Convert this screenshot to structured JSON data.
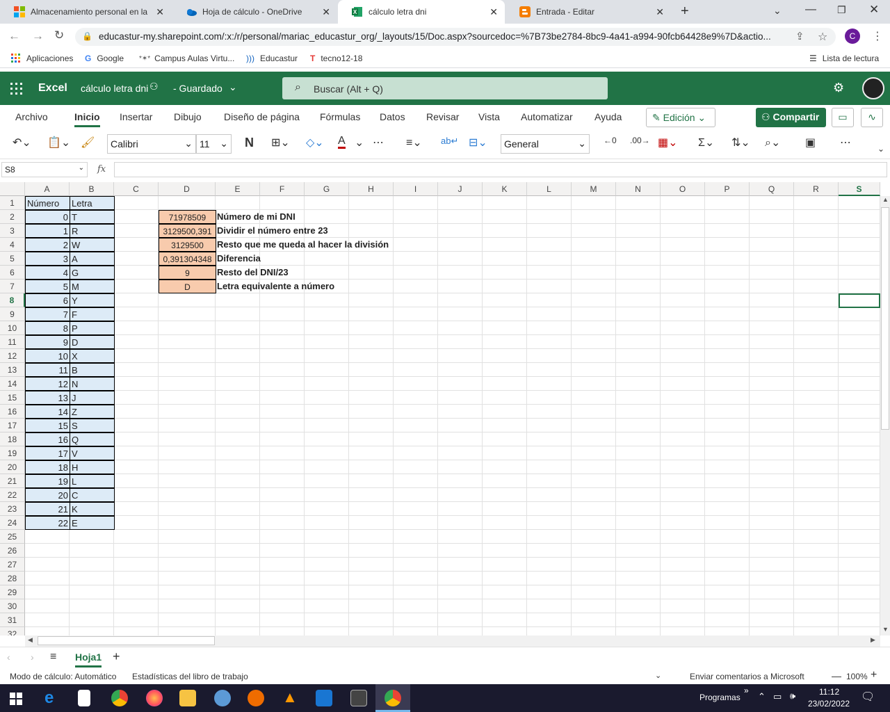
{
  "browser": {
    "tabs": [
      {
        "title": "Almacenamiento personal en la r",
        "icon": "microsoft-icon"
      },
      {
        "title": "Hoja de cálculo - OneDrive",
        "icon": "onedrive-icon"
      },
      {
        "title": "cálculo letra dni",
        "icon": "excel-icon",
        "active": true
      },
      {
        "title": "Entrada - Editar",
        "icon": "blogger-icon"
      }
    ],
    "url": "educastur-my.sharepoint.com/:x:/r/personal/mariac_educastur_org/_layouts/15/Doc.aspx?sourcedoc=%7B73be2784-8bc9-4a41-a994-90fcb64428e9%7D&actio...",
    "profile_initial": "C",
    "bookmarks": [
      "Aplicaciones",
      "Google",
      "Campus Aulas Virtu...",
      "Educastur",
      "tecno12-18"
    ],
    "reading_list": "Lista de lectura"
  },
  "excel": {
    "app_name": "Excel",
    "doc_title": "cálculo letra dni",
    "save_status": "- Guardado",
    "search_placeholder": "Buscar (Alt + Q)",
    "menu": [
      "Archivo",
      "Inicio",
      "Insertar",
      "Dibujo",
      "Diseño de página",
      "Fórmulas",
      "Datos",
      "Revisar",
      "Vista",
      "Automatizar",
      "Ayuda"
    ],
    "edit_mode": "Edición",
    "share": "Compartir",
    "font": "Calibri",
    "font_size": "11",
    "bold": "N",
    "number_format": "General",
    "name_box": "S8",
    "fx": "fx"
  },
  "columns": [
    "A",
    "B",
    "C",
    "D",
    "E",
    "F",
    "G",
    "H",
    "I",
    "J",
    "K",
    "L",
    "M",
    "N",
    "O",
    "P",
    "Q",
    "R",
    "S"
  ],
  "rows": [
    "1",
    "2",
    "3",
    "4",
    "5",
    "6",
    "7",
    "8",
    "9",
    "10",
    "11",
    "12",
    "13",
    "14",
    "15",
    "16",
    "17",
    "18",
    "19",
    "20",
    "21",
    "22",
    "23",
    "24",
    "25",
    "26",
    "27",
    "28",
    "29",
    "30",
    "31",
    "32"
  ],
  "table_ab": {
    "header_a": "Número",
    "header_b": "Letra",
    "numbers": [
      "0",
      "1",
      "2",
      "3",
      "4",
      "5",
      "6",
      "7",
      "8",
      "9",
      "10",
      "11",
      "12",
      "13",
      "14",
      "15",
      "16",
      "17",
      "18",
      "19",
      "20",
      "21",
      "22"
    ],
    "letters": [
      "T",
      "R",
      "W",
      "A",
      "G",
      "M",
      "Y",
      "F",
      "P",
      "D",
      "X",
      "B",
      "N",
      "J",
      "Z",
      "S",
      "Q",
      "V",
      "H",
      "L",
      "C",
      "K",
      "E"
    ]
  },
  "calc": [
    {
      "value": "71978509",
      "label": "Número de mi DNI"
    },
    {
      "value": "3129500,391",
      "label": "Dividir el número entre 23"
    },
    {
      "value": "3129500",
      "label": "Resto que me queda al hacer la división"
    },
    {
      "value": "0,391304348",
      "label": "Diferencia"
    },
    {
      "value": "9",
      "label": "Resto del DNI/23"
    },
    {
      "value": "D",
      "label": "Letra equivalente a número"
    }
  ],
  "sheet_tab": "Hoja1",
  "status": {
    "calc_mode": "Modo de cálculo: Automático",
    "stats": "Estadísticas del libro de trabajo",
    "feedback": "Enviar comentarios a Microsoft",
    "zoom": "100%"
  },
  "taskbar": {
    "programs": "Programas",
    "time": "11:12",
    "date": "23/02/2022"
  },
  "colors": {
    "excel_green": "#217346",
    "table_blue": "#ddebf7",
    "calc_peach": "#f8cbad"
  }
}
